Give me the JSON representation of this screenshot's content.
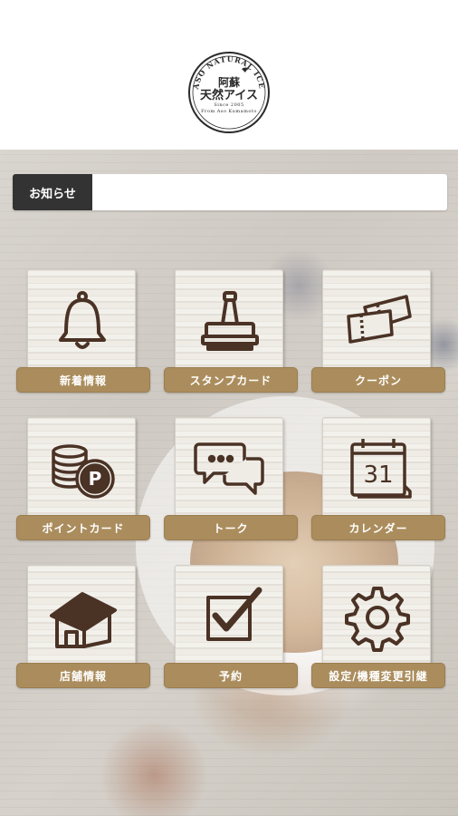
{
  "header": {
    "logo": {
      "arc_text": "ASO NATURAL ICE",
      "name_line1": "阿蘇",
      "name_line2": "天然アイス",
      "since": "Since 2005",
      "tagline": "From Aso Kumamoto"
    }
  },
  "notice": {
    "label": "お知らせ",
    "message": ""
  },
  "menu": [
    {
      "label": "新着情報",
      "icon": "bell-icon"
    },
    {
      "label": "スタンプカード",
      "icon": "stamp-icon"
    },
    {
      "label": "クーポン",
      "icon": "coupon-icon"
    },
    {
      "label": "ポイントカード",
      "icon": "coins-icon"
    },
    {
      "label": "トーク",
      "icon": "chat-bubbles-icon"
    },
    {
      "label": "カレンダー",
      "icon": "calendar-icon",
      "calendar_day": "31"
    },
    {
      "label": "店舗情報",
      "icon": "house-icon"
    },
    {
      "label": "予約",
      "icon": "checkbox-icon"
    },
    {
      "label": "設定/機種変更引継",
      "icon": "gear-icon"
    }
  ],
  "colors": {
    "label_bg": "#ab8d5d",
    "icon_stroke": "#4a3225",
    "notice_label_bg": "#333333"
  }
}
